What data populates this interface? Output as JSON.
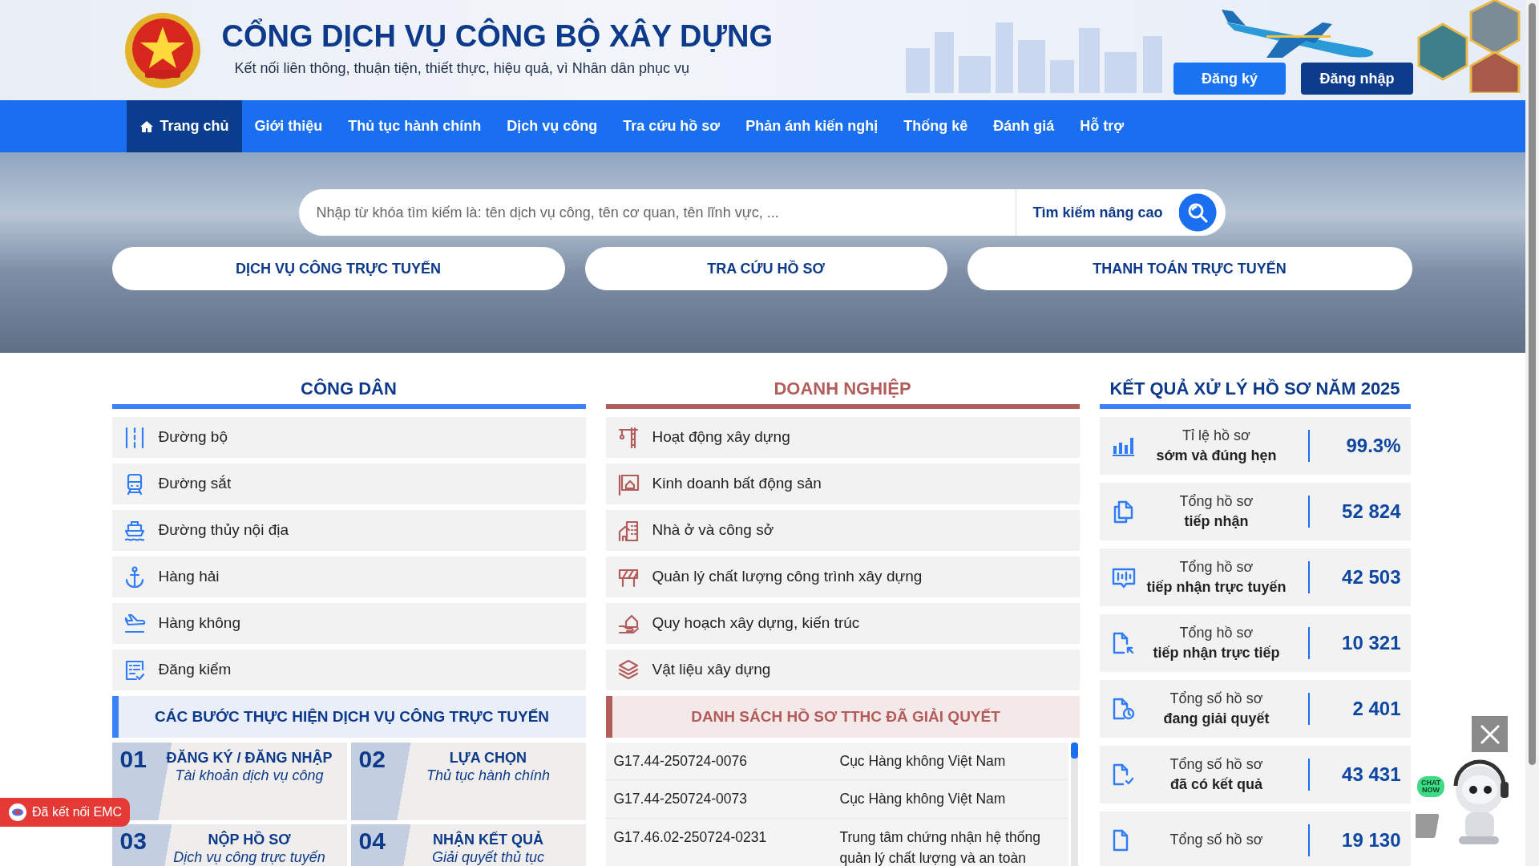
{
  "header": {
    "title": "CỔNG DỊCH VỤ CÔNG BỘ XÂY DỰNG",
    "subtitle": "Kết nối liên thông, thuận tiện, thiết thực, hiệu quả, vì Nhân dân phục vụ",
    "buttons": [
      {
        "label": "Đăng ký",
        "kind": "register"
      },
      {
        "label": "Đăng nhập",
        "kind": "login"
      }
    ]
  },
  "nav": [
    {
      "label": "Trang chủ",
      "selected": true
    },
    {
      "label": "Giới thiệu",
      "selected": false
    },
    {
      "label": "Thủ tục hành chính",
      "selected": false
    },
    {
      "label": "Dịch vụ công",
      "selected": false
    },
    {
      "label": "Tra cứu hồ sơ",
      "selected": false
    },
    {
      "label": "Phản ánh kiến nghị",
      "selected": false
    },
    {
      "label": "Thống kê",
      "selected": false
    },
    {
      "label": "Đánh giá",
      "selected": false
    },
    {
      "label": "Hỗ trợ",
      "selected": false
    }
  ],
  "search": {
    "placeholder": "Nhập từ khóa tìm kiếm là: tên dịch vụ công, tên cơ quan, tên lĩnh vực, ...",
    "advanced": "Tìm kiếm nâng cao"
  },
  "quick_links": [
    "DỊCH VỤ CÔNG TRỰC TUYẾN",
    "TRA CỨU HỒ SƠ",
    "THANH TOÁN TRỰC TUYẾN"
  ],
  "citizen": {
    "title": "CÔNG DÂN",
    "items": [
      "Đường bộ",
      "Đường sắt",
      "Đường thủy nội địa",
      "Hàng hải",
      "Hàng không",
      "Đăng kiểm"
    ]
  },
  "steps": {
    "title": "CÁC BƯỚC THỰC HIỆN DỊCH VỤ CÔNG TRỰC TUYẾN",
    "items": [
      {
        "number": "01",
        "title": "ĐĂNG KÝ / ĐĂNG NHẬP",
        "subtitle": "Tài khoản dịch vụ công"
      },
      {
        "number": "02",
        "title": "LỰA CHỌN",
        "subtitle": "Thủ tục hành chính"
      },
      {
        "number": "03",
        "title": "NỘP HỒ SƠ",
        "subtitle": "Dịch vụ công trực tuyến"
      },
      {
        "number": "04",
        "title": "NHẬN KẾT QUẢ",
        "subtitle": "Giải quyết thủ tục"
      }
    ]
  },
  "business": {
    "title": "DOANH NGHIỆP",
    "items": [
      "Hoạt động xây dựng",
      "Kinh doanh bất động sản",
      "Nhà ở và công sở",
      "Quản lý chất lượng công trình xây dựng",
      "Quy hoạch xây dựng, kiến trúc",
      "Vật liệu xây dựng"
    ]
  },
  "resolved": {
    "title": "DANH SÁCH HỒ SƠ TTHC ĐÃ GIẢI QUYẾT",
    "rows": [
      {
        "code": "G17.44-250724-0076",
        "agency": "Cục Hàng không Việt Nam"
      },
      {
        "code": "G17.44-250724-0073",
        "agency": "Cục Hàng không Việt Nam"
      },
      {
        "code": "G17.46.02-250724-0231",
        "agency": "Trung tâm chứng nhận hệ thống quản lý chất lượng và an toàn"
      }
    ]
  },
  "results": {
    "title": "KẾT QUẢ XỬ LÝ HỒ SƠ NĂM 2025",
    "items": [
      {
        "label": "Tỉ lệ hồ sơ",
        "detail": "sớm và đúng hẹn",
        "value": "99.3%"
      },
      {
        "label": "Tổng hồ sơ",
        "detail": "tiếp nhận",
        "value": "52 824"
      },
      {
        "label": "Tổng hồ sơ",
        "detail": "tiếp nhận trực tuyến",
        "value": "42 503"
      },
      {
        "label": "Tổng hồ sơ",
        "detail": "tiếp nhận trực tiếp",
        "value": "10 321"
      },
      {
        "label": "Tổng số hồ sơ",
        "detail": "đang giải quyết",
        "value": "2 401"
      },
      {
        "label": "Tổng số hồ sơ",
        "detail": "đã có kết quả",
        "value": "43 431"
      },
      {
        "label": "Tổng số hồ sơ",
        "value": "19 130"
      }
    ]
  },
  "emc_badge": "Đã kết nối EMC",
  "chat": {
    "bubble": "CHAT NOW"
  }
}
